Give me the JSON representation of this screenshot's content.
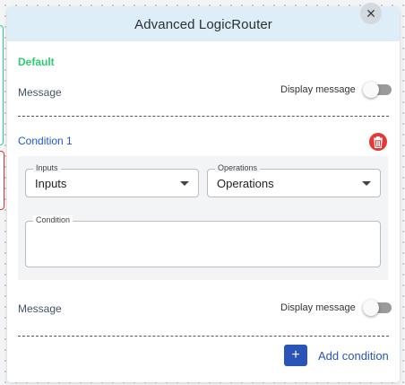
{
  "dialog": {
    "title": "Advanced LogicRouter",
    "close_icon": "close-icon"
  },
  "default_section": {
    "label": "Default",
    "message_label": "Message",
    "display_message_label": "Display message",
    "display_message_enabled": false
  },
  "conditions": [
    {
      "title": "Condition 1",
      "delete_icon": "trash-icon",
      "inputs": {
        "legend": "Inputs",
        "value": "Inputs"
      },
      "operations": {
        "legend": "Operations",
        "value": "Operations"
      },
      "condition": {
        "legend": "Condition",
        "value": ""
      },
      "message_label": "Message",
      "display_message_label": "Display message",
      "display_message_enabled": false
    }
  ],
  "actions": {
    "add_condition_label": "Add condition",
    "add_icon": "plus-icon"
  },
  "colors": {
    "header_bg": "#deeef9",
    "default_label": "#2ecc71",
    "condition_title": "#1e5bc6",
    "delete_button": "#e53935",
    "add_button": "#2a54b8"
  }
}
